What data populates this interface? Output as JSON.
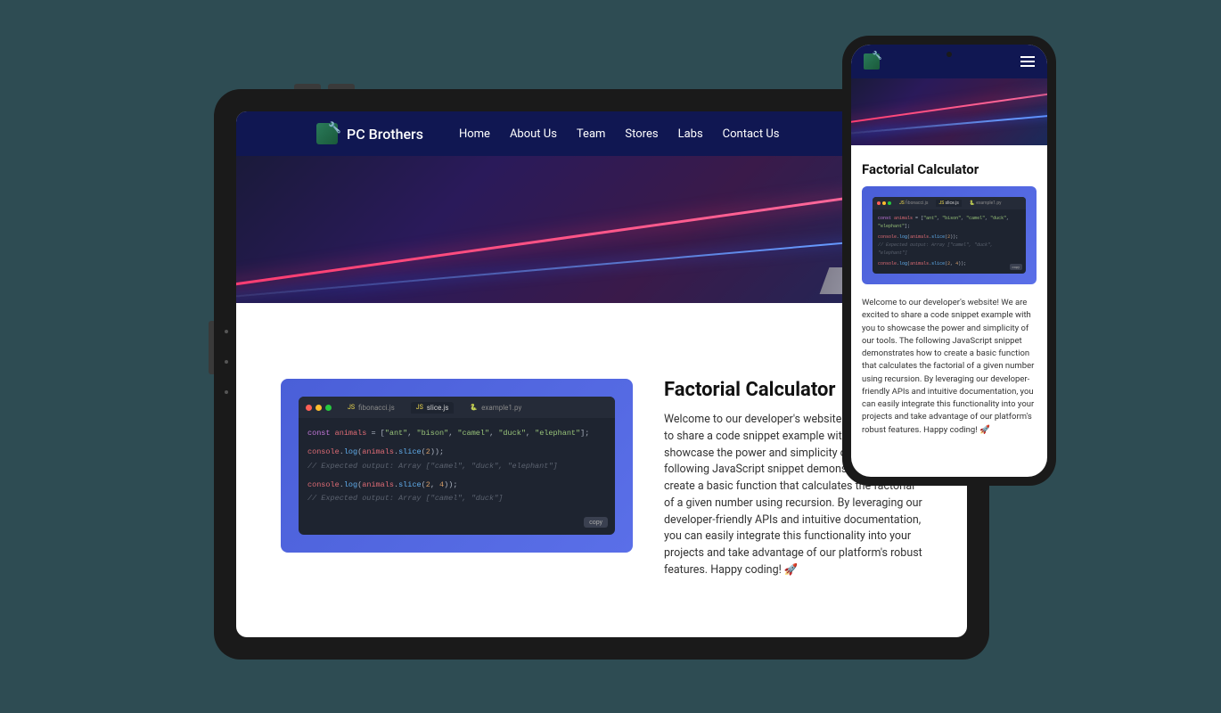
{
  "brand": "PC Brothers",
  "nav": {
    "home": "Home",
    "about": "About Us",
    "team": "Team",
    "stores": "Stores",
    "labs": "Labs",
    "contact": "Contact Us"
  },
  "section": {
    "title": "Factorial Calculator",
    "description": "Welcome to our developer's website! We are excited to share a code snippet example with you to showcase the power and simplicity of our tools. The following JavaScript snippet demonstrates how to create a basic function that calculates the factorial of a given number using recursion. By leveraging our developer-friendly APIs and intuitive documentation, you can easily integrate this functionality into your projects and take advantage of our platform's robust features. Happy coding! 🚀"
  },
  "editor": {
    "tabs": {
      "fibonacci": "fibonacci.js",
      "slice": "slice.js",
      "example": "example1.py"
    },
    "copy": "copy",
    "code": {
      "line1_kw": "const",
      "line1_var": "animals",
      "line1_eq": " = [",
      "line1_s1": "\"ant\"",
      "line1_s2": "\"bison\"",
      "line1_s3": "\"camel\"",
      "line1_s4": "\"duck\"",
      "line1_s5": "\"elephant\"",
      "line1_end": "];",
      "line2_obj": "console",
      "line2_dot": ".",
      "line2_fn": "log",
      "line2_open": "(",
      "line2_var": "animals",
      "line2_fn2": "slice",
      "line2_num": "2",
      "line2_close": "));",
      "line3": "// Expected output: Array [\"camel\", \"duck\", \"elephant\"]",
      "line4_num1": "2",
      "line4_num2": "4",
      "line5": "// Expected output: Array [\"camel\", \"duck\"]"
    }
  }
}
